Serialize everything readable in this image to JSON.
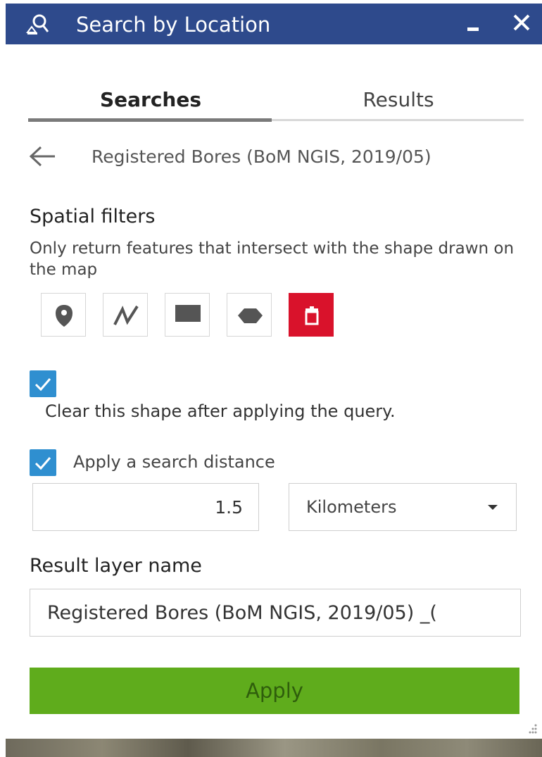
{
  "window": {
    "title": "Search by Location",
    "icon": "search-location-icon"
  },
  "tabs": [
    {
      "label": "Searches",
      "active": true
    },
    {
      "label": "Results",
      "active": false
    }
  ],
  "layer": {
    "title": "Registered Bores (BoM NGIS, 2019/05)"
  },
  "spatial_filters": {
    "title": "Spatial filters",
    "description": "Only return features that intersect with the shape drawn on the map",
    "tools": [
      "point-icon",
      "polyline-icon",
      "rectangle-icon",
      "polygon-icon",
      "trash-icon"
    ]
  },
  "options": {
    "clear_shape": {
      "label": "Clear this shape after applying the query.",
      "checked": true
    },
    "search_distance": {
      "label": "Apply a search distance",
      "checked": true,
      "value": "1.5",
      "unit": "Kilometers"
    }
  },
  "result_layer": {
    "label": "Result layer name",
    "value": "Registered Bores (BoM NGIS, 2019/05) _("
  },
  "actions": {
    "apply_label": "Apply"
  },
  "colors": {
    "titlebar": "#2e4a8c",
    "checkbox": "#2f8fd0",
    "delete": "#d9122b",
    "apply": "#5fac1c"
  }
}
